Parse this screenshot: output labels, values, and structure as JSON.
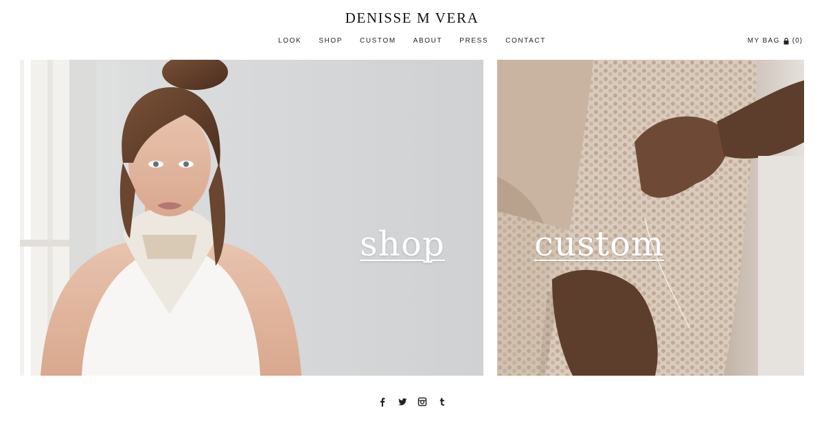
{
  "brand": {
    "name": "DENISSE M VERA"
  },
  "nav": [
    {
      "label": "LOOK"
    },
    {
      "label": "SHOP"
    },
    {
      "label": "CUSTOM"
    },
    {
      "label": "ABOUT"
    },
    {
      "label": "PRESS"
    },
    {
      "label": "CONTACT"
    }
  ],
  "bag": {
    "label": "MY BAG",
    "count": "(0)",
    "icon": "lock-icon"
  },
  "panels": {
    "shop": {
      "label": "shop"
    },
    "custom": {
      "label": "custom"
    }
  },
  "social": [
    {
      "name": "facebook-icon"
    },
    {
      "name": "twitter-icon"
    },
    {
      "name": "instagram-icon"
    },
    {
      "name": "tumblr-icon"
    }
  ],
  "colors": {
    "background": "#ffffff",
    "text": "#1a1a1a",
    "shop_wall": "#d8dadc",
    "custom_tone": "#8a7160"
  }
}
